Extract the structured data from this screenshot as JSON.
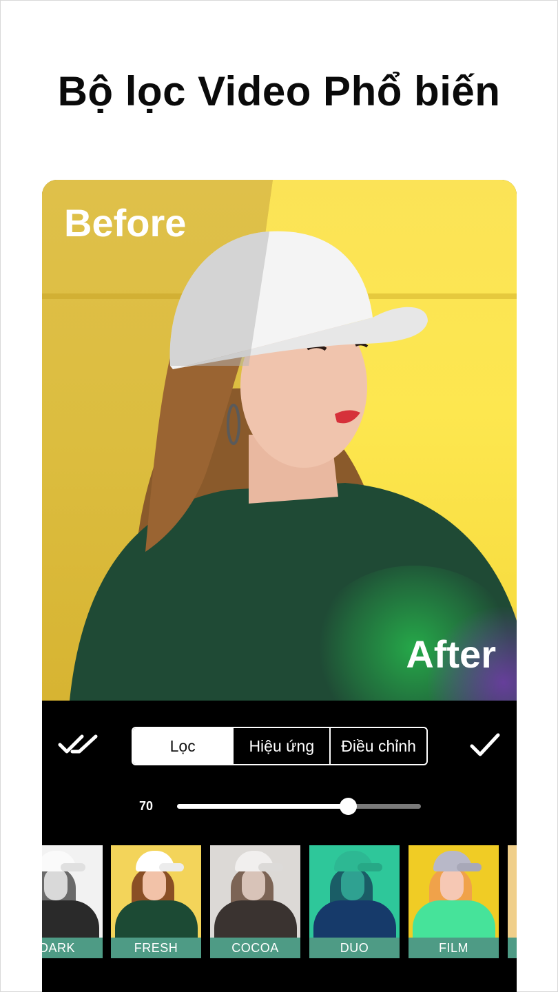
{
  "headline": "Bộ lọc Video Phổ biến",
  "preview": {
    "before_label": "Before",
    "after_label": "After"
  },
  "toolbar": {
    "apply_all_icon": "double-check-icon",
    "confirm_icon": "check-icon",
    "tabs": [
      {
        "label": "Lọc",
        "active": true
      },
      {
        "label": "Hiệu ứng",
        "active": false
      },
      {
        "label": "Điều chỉnh",
        "active": false
      }
    ],
    "intensity": {
      "value": 70,
      "label": "70",
      "max": 100
    }
  },
  "filters": [
    {
      "label": "DARK",
      "style": "mono"
    },
    {
      "label": "FRESH",
      "style": "fresh"
    },
    {
      "label": "COCOA",
      "style": "cocoa"
    },
    {
      "label": "DUO",
      "style": "duo"
    },
    {
      "label": "FILM",
      "style": "film"
    },
    {
      "label": "",
      "style": "partial"
    }
  ],
  "colors": {
    "label_bar": "#4e9b85",
    "background": "#ffffff",
    "toolbar": "#000000"
  }
}
